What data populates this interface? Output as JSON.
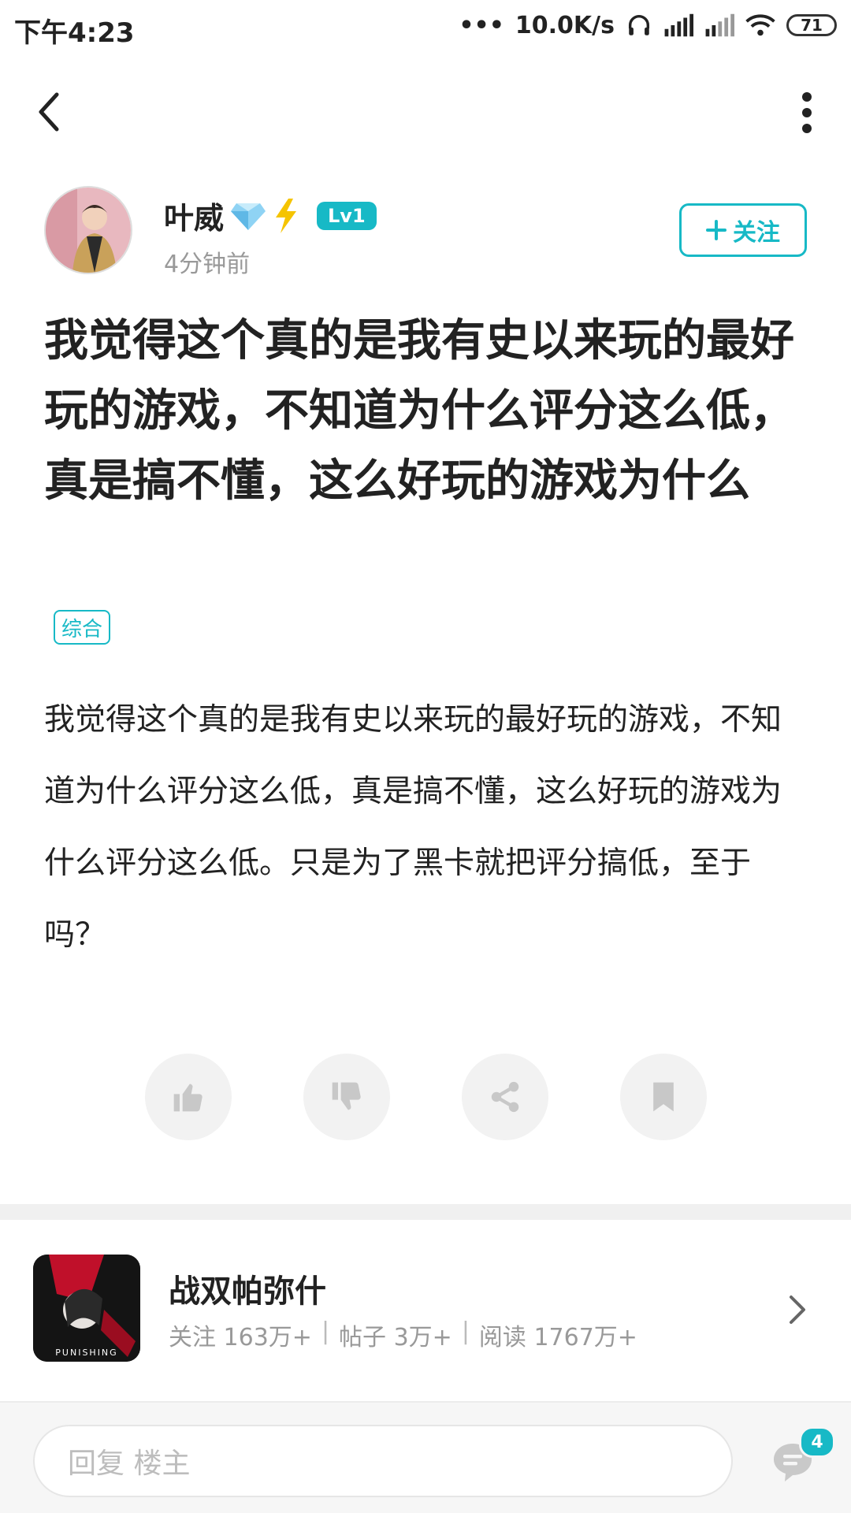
{
  "status_bar": {
    "time": "下午4:23",
    "network_speed": "10.0K/s",
    "battery": "71"
  },
  "nav": {
    "back_icon": "chevron-left-icon",
    "more_icon": "more-vertical-icon"
  },
  "author": {
    "name": "叶威",
    "level": "Lv1",
    "time_ago": "4分钟前",
    "follow_label": "关注"
  },
  "post": {
    "title": "我觉得这个真的是我有史以来玩的最好玩的游戏，不知道为什么评分这么低，真是搞不懂，这么好玩的游戏为什么",
    "tag": "综合",
    "body": "我觉得这个真的是我有史以来玩的最好玩的游戏，不知道为什么评分这么低，真是搞不懂，这么好玩的游戏为什么评分这么低。只是为了黑卡就把评分搞低，至于吗？"
  },
  "actions": [
    "thumb-up-icon",
    "thumb-down-icon",
    "share-icon",
    "bookmark-icon"
  ],
  "game": {
    "name": "战双帕弥什",
    "follows": "关注 163万+",
    "posts": "帖子 3万+",
    "reads": "阅读 1767万+",
    "icon_text": "PUNISHING",
    "separator": "|"
  },
  "bottom_bar": {
    "reply_placeholder": "回复  楼主",
    "comment_count": "4"
  },
  "colors": {
    "accent": "#17b9c6",
    "text": "#222222",
    "muted": "#999999"
  }
}
